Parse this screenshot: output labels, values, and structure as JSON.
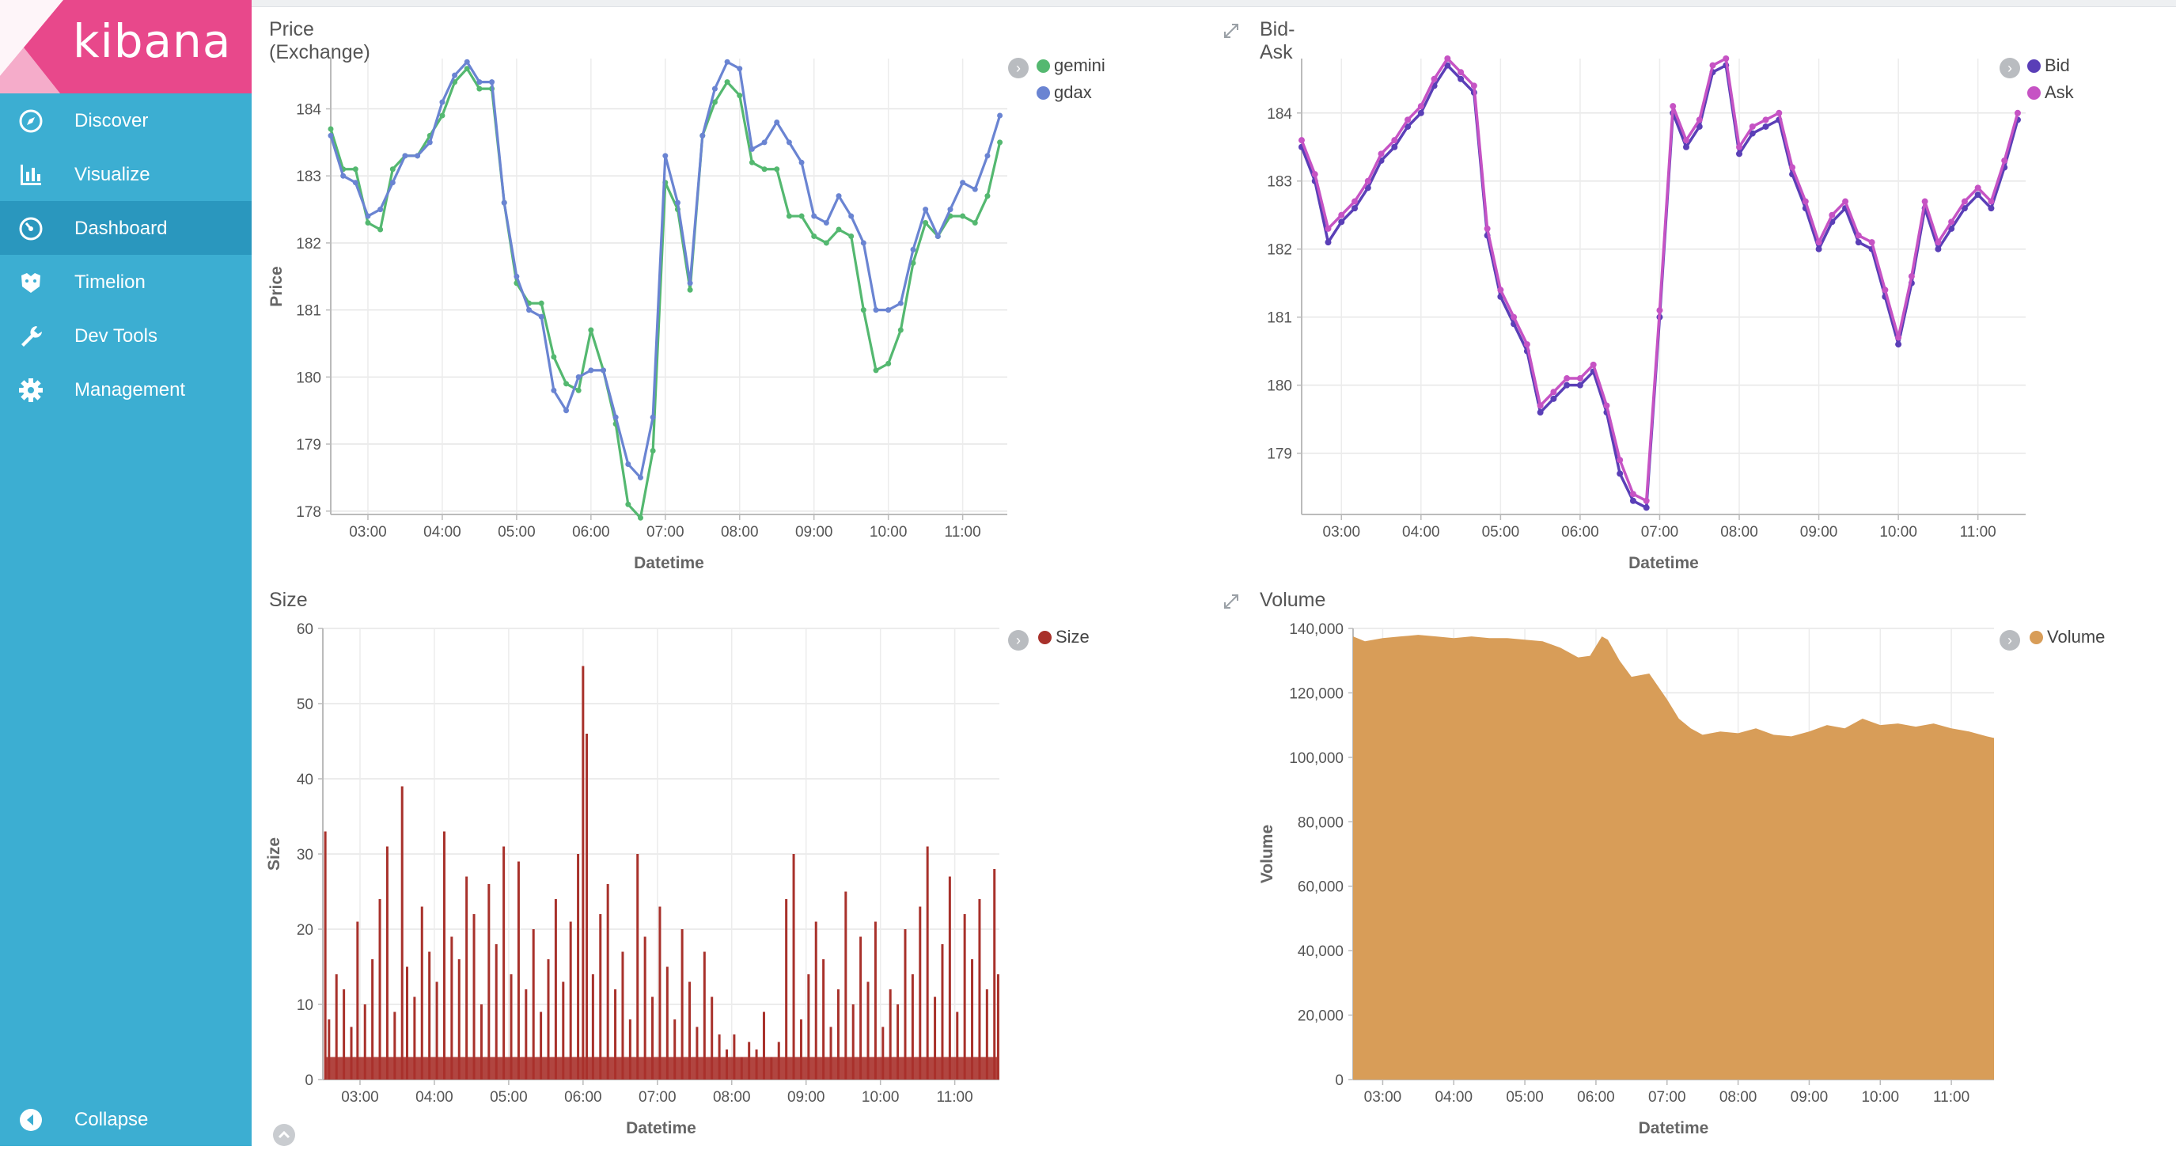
{
  "app": {
    "logo_text": "kibana",
    "brand_color": "#e8488b",
    "sidebar_color": "#3caed2",
    "sidebar_active_color": "#2a97be"
  },
  "nav": {
    "items": [
      {
        "label": "Discover",
        "icon": "compass-icon",
        "active": false
      },
      {
        "label": "Visualize",
        "icon": "bar-chart-icon",
        "active": false
      },
      {
        "label": "Dashboard",
        "icon": "dashboard-icon",
        "active": true
      },
      {
        "label": "Timelion",
        "icon": "timelion-icon",
        "active": false
      },
      {
        "label": "Dev Tools",
        "icon": "wrench-icon",
        "active": false
      },
      {
        "label": "Management",
        "icon": "gear-icon",
        "active": false
      }
    ],
    "collapse_label": "Collapse"
  },
  "panels": {
    "price": {
      "title": "Price (Exchange)"
    },
    "bidask": {
      "title": "Bid-Ask"
    },
    "size": {
      "title": "Size"
    },
    "volume": {
      "title": "Volume"
    }
  },
  "chart_data": [
    {
      "id": "price",
      "type": "line",
      "title": "Price (Exchange)",
      "xlabel": "Datetime",
      "ylabel": "Price",
      "x_ticks": [
        "03:00",
        "04:00",
        "05:00",
        "06:00",
        "07:00",
        "08:00",
        "09:00",
        "10:00",
        "11:00"
      ],
      "x": [
        "02:30",
        "02:40",
        "02:50",
        "03:00",
        "03:10",
        "03:20",
        "03:30",
        "03:40",
        "03:50",
        "04:00",
        "04:10",
        "04:20",
        "04:30",
        "04:40",
        "04:50",
        "05:00",
        "05:10",
        "05:20",
        "05:30",
        "05:40",
        "05:50",
        "06:00",
        "06:10",
        "06:20",
        "06:30",
        "06:40",
        "06:50",
        "07:00",
        "07:10",
        "07:20",
        "07:30",
        "07:40",
        "07:50",
        "08:00",
        "08:10",
        "08:20",
        "08:30",
        "08:40",
        "08:50",
        "09:00",
        "09:10",
        "09:20",
        "09:30",
        "09:40",
        "09:50",
        "10:00",
        "10:10",
        "10:20",
        "10:30",
        "10:40",
        "10:50",
        "11:00",
        "11:10",
        "11:20",
        "11:30"
      ],
      "y_ticks": [
        178,
        179,
        180,
        181,
        182,
        183,
        184
      ],
      "ylim": [
        177.95,
        184.75
      ],
      "xlim": [
        "02:30",
        "11:36"
      ],
      "series": [
        {
          "name": "gemini",
          "color": "#54b870",
          "values": [
            183.7,
            183.1,
            183.1,
            182.3,
            182.2,
            183.1,
            183.3,
            183.3,
            183.6,
            183.9,
            184.4,
            184.6,
            184.3,
            184.3,
            182.6,
            181.4,
            181.1,
            181.1,
            180.3,
            179.9,
            179.8,
            180.7,
            180.1,
            179.3,
            178.1,
            177.9,
            178.9,
            182.9,
            182.5,
            181.3,
            183.6,
            184.1,
            184.4,
            184.2,
            183.2,
            183.1,
            183.1,
            182.4,
            182.4,
            182.1,
            182.0,
            182.2,
            182.1,
            181.0,
            180.1,
            180.2,
            180.7,
            181.7,
            182.3,
            182.1,
            182.4,
            182.4,
            182.3,
            182.7,
            183.5
          ]
        },
        {
          "name": "gdax",
          "color": "#6a84d2",
          "values": [
            183.6,
            183.0,
            182.9,
            182.4,
            182.5,
            182.9,
            183.3,
            183.3,
            183.5,
            184.1,
            184.5,
            184.7,
            184.4,
            184.4,
            182.6,
            181.5,
            181.0,
            180.9,
            179.8,
            179.5,
            180.0,
            180.1,
            180.1,
            179.4,
            178.7,
            178.5,
            179.4,
            183.3,
            182.6,
            181.4,
            183.6,
            184.3,
            184.7,
            184.6,
            183.4,
            183.5,
            183.8,
            183.5,
            183.2,
            182.4,
            182.3,
            182.7,
            182.4,
            182.0,
            181.0,
            181.0,
            181.1,
            181.9,
            182.5,
            182.1,
            182.5,
            182.9,
            182.8,
            183.3,
            183.9
          ]
        }
      ]
    },
    {
      "id": "bidask",
      "type": "line",
      "title": "Bid-Ask",
      "xlabel": "Datetime",
      "x_ticks": [
        "03:00",
        "04:00",
        "05:00",
        "06:00",
        "07:00",
        "08:00",
        "09:00",
        "10:00",
        "11:00"
      ],
      "x": [
        "02:30",
        "02:40",
        "02:50",
        "03:00",
        "03:10",
        "03:20",
        "03:30",
        "03:40",
        "03:50",
        "04:00",
        "04:10",
        "04:20",
        "04:30",
        "04:40",
        "04:50",
        "05:00",
        "05:10",
        "05:20",
        "05:30",
        "05:40",
        "05:50",
        "06:00",
        "06:10",
        "06:20",
        "06:30",
        "06:40",
        "06:50",
        "07:00",
        "07:10",
        "07:20",
        "07:30",
        "07:40",
        "07:50",
        "08:00",
        "08:10",
        "08:20",
        "08:30",
        "08:40",
        "08:50",
        "09:00",
        "09:10",
        "09:20",
        "09:30",
        "09:40",
        "09:50",
        "10:00",
        "10:10",
        "10:20",
        "10:30",
        "10:40",
        "10:50",
        "11:00",
        "11:10",
        "11:20",
        "11:30"
      ],
      "y_ticks": [
        179,
        180,
        181,
        182,
        183,
        184
      ],
      "ylim": [
        178.1,
        184.8
      ],
      "xlim": [
        "02:30",
        "11:36"
      ],
      "series": [
        {
          "name": "Bid",
          "color": "#5a3fb7",
          "values": [
            183.5,
            183.0,
            182.1,
            182.4,
            182.6,
            182.9,
            183.3,
            183.5,
            183.8,
            184.0,
            184.4,
            184.7,
            184.5,
            184.3,
            182.2,
            181.3,
            180.9,
            180.5,
            179.6,
            179.8,
            180.0,
            180.0,
            180.2,
            179.6,
            178.7,
            178.3,
            178.2,
            181.0,
            184.0,
            183.5,
            183.8,
            184.6,
            184.7,
            183.4,
            183.7,
            183.8,
            183.9,
            183.1,
            182.6,
            182.0,
            182.4,
            182.6,
            182.1,
            182.0,
            181.3,
            180.6,
            181.5,
            182.6,
            182.0,
            182.3,
            182.6,
            182.8,
            182.6,
            183.2,
            183.9
          ]
        },
        {
          "name": "Ask",
          "color": "#c653c4",
          "values": [
            183.6,
            183.1,
            182.3,
            182.5,
            182.7,
            183.0,
            183.4,
            183.6,
            183.9,
            184.1,
            184.5,
            184.8,
            184.6,
            184.4,
            182.3,
            181.4,
            181.0,
            180.6,
            179.7,
            179.9,
            180.1,
            180.1,
            180.3,
            179.7,
            178.9,
            178.4,
            178.3,
            181.1,
            184.1,
            183.6,
            183.9,
            184.7,
            184.8,
            183.5,
            183.8,
            183.9,
            184.0,
            183.2,
            182.7,
            182.1,
            182.5,
            182.7,
            182.2,
            182.1,
            181.4,
            180.7,
            181.6,
            182.7,
            182.1,
            182.4,
            182.7,
            182.9,
            182.7,
            183.3,
            184.0
          ]
        }
      ],
      "legend": [
        "Bid",
        "Ask"
      ]
    },
    {
      "id": "size",
      "type": "bar",
      "title": "Size",
      "xlabel": "Datetime",
      "ylabel": "Size",
      "x_ticks": [
        "03:00",
        "04:00",
        "05:00",
        "06:00",
        "07:00",
        "08:00",
        "09:00",
        "10:00",
        "11:00"
      ],
      "y_ticks": [
        0,
        10,
        20,
        30,
        40,
        50,
        60
      ],
      "ylim": [
        0,
        60
      ],
      "xlim": [
        "02:30",
        "11:36"
      ],
      "series": [
        {
          "name": "Size",
          "color": "#a8312b",
          "x": [
            "02:32",
            "02:35",
            "02:41",
            "02:47",
            "02:53",
            "02:58",
            "03:04",
            "03:10",
            "03:16",
            "03:22",
            "03:28",
            "03:34",
            "03:38",
            "03:44",
            "03:50",
            "03:56",
            "04:02",
            "04:08",
            "04:14",
            "04:20",
            "04:26",
            "04:32",
            "04:38",
            "04:44",
            "04:50",
            "04:56",
            "05:02",
            "05:08",
            "05:14",
            "05:20",
            "05:26",
            "05:32",
            "05:38",
            "05:44",
            "05:50",
            "05:56",
            "06:00",
            "06:03",
            "06:08",
            "06:14",
            "06:20",
            "06:26",
            "06:32",
            "06:38",
            "06:44",
            "06:50",
            "06:56",
            "07:02",
            "07:08",
            "07:14",
            "07:20",
            "07:26",
            "07:32",
            "07:38",
            "07:44",
            "07:50",
            "07:56",
            "08:02",
            "08:08",
            "08:14",
            "08:20",
            "08:26",
            "08:32",
            "08:38",
            "08:44",
            "08:50",
            "08:56",
            "09:02",
            "09:08",
            "09:14",
            "09:20",
            "09:26",
            "09:32",
            "09:38",
            "09:44",
            "09:50",
            "09:56",
            "10:02",
            "10:08",
            "10:14",
            "10:20",
            "10:26",
            "10:32",
            "10:38",
            "10:44",
            "10:50",
            "10:56",
            "11:02",
            "11:08",
            "11:14",
            "11:20",
            "11:26",
            "11:32",
            "11:35"
          ],
          "values": [
            33,
            8,
            14,
            12,
            7,
            21,
            10,
            16,
            24,
            31,
            9,
            39,
            15,
            11,
            23,
            17,
            13,
            33,
            19,
            16,
            27,
            22,
            10,
            26,
            18,
            31,
            14,
            29,
            12,
            20,
            9,
            16,
            24,
            13,
            21,
            30,
            55,
            46,
            14,
            22,
            26,
            12,
            17,
            8,
            30,
            19,
            11,
            23,
            15,
            8,
            20,
            13,
            7,
            17,
            11,
            6,
            4,
            6,
            3,
            5,
            4,
            9,
            3,
            5,
            24,
            30,
            8,
            14,
            21,
            16,
            7,
            12,
            25,
            10,
            19,
            13,
            21,
            7,
            12,
            10,
            20,
            14,
            23,
            31,
            11,
            18,
            27,
            9,
            22,
            16,
            24,
            12,
            28,
            14
          ]
        }
      ]
    },
    {
      "id": "volume",
      "type": "area",
      "title": "Volume",
      "xlabel": "Datetime",
      "ylabel": "Volume",
      "x_ticks": [
        "03:00",
        "04:00",
        "05:00",
        "06:00",
        "07:00",
        "08:00",
        "09:00",
        "10:00",
        "11:00"
      ],
      "y_ticks": [
        0,
        20000,
        40000,
        60000,
        80000,
        100000,
        120000,
        140000
      ],
      "y_tick_labels": [
        "0",
        "20,000",
        "40,000",
        "60,000",
        "80,000",
        "100,000",
        "120,000",
        "140,000"
      ],
      "ylim": [
        0,
        140000
      ],
      "xlim": [
        "02:35",
        "11:36"
      ],
      "series": [
        {
          "name": "Volume",
          "color": "#d89d58",
          "x": [
            "02:35",
            "02:45",
            "03:00",
            "03:15",
            "03:30",
            "03:45",
            "04:00",
            "04:15",
            "04:30",
            "04:45",
            "05:00",
            "05:15",
            "05:30",
            "05:45",
            "05:55",
            "06:05",
            "06:10",
            "06:20",
            "06:30",
            "06:45",
            "07:00",
            "07:10",
            "07:20",
            "07:30",
            "07:45",
            "08:00",
            "08:15",
            "08:30",
            "08:45",
            "09:00",
            "09:15",
            "09:30",
            "09:45",
            "10:00",
            "10:15",
            "10:30",
            "10:45",
            "11:00",
            "11:15",
            "11:30",
            "11:36"
          ],
          "values": [
            137500,
            136000,
            137000,
            137500,
            138000,
            137500,
            137000,
            137500,
            137000,
            137000,
            136500,
            136000,
            134000,
            131000,
            131500,
            137500,
            136500,
            130000,
            125000,
            126000,
            118000,
            112000,
            109000,
            107000,
            108000,
            107500,
            109000,
            107000,
            106500,
            108000,
            110000,
            109000,
            112000,
            110000,
            110500,
            109500,
            110500,
            109000,
            108000,
            106500,
            106000
          ]
        }
      ]
    }
  ]
}
